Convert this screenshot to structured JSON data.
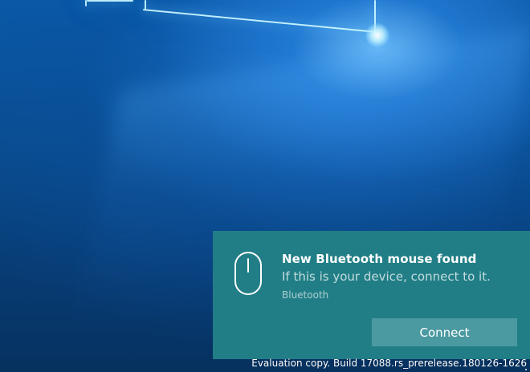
{
  "toast": {
    "title": "New Bluetooth mouse found",
    "message": "If this is your device, connect to it.",
    "source": "Bluetooth",
    "button_label": "Connect",
    "icon": "mouse-icon"
  },
  "watermark": {
    "text": "Evaluation copy. Build 17088.rs_prerelease.180126-1626"
  },
  "colors": {
    "toast_bg": "#217e86",
    "button_bg": "#4c9aa1",
    "desktop_bg": "#0b4f8f"
  }
}
